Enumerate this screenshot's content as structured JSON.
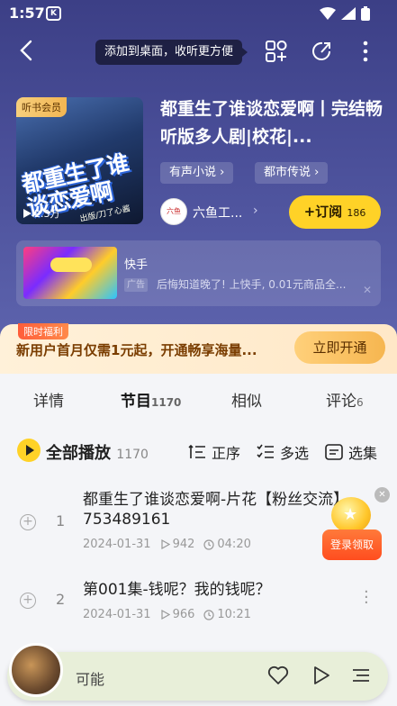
{
  "status": {
    "time": "1:57",
    "app_badge": "K"
  },
  "nav": {
    "tooltip": "添加到桌面，收听更方便"
  },
  "album": {
    "cover_badge": "听书会员",
    "cover_title": "都重生了谁谈恋爱啊",
    "cover_subtitle": "出版/刀了心酱",
    "cover_plays": "2.3万",
    "title": "都重生了谁谈恋爱啊丨完结畅听版多人剧|校花|...",
    "tags": [
      "有声小说",
      "都市传说"
    ],
    "author_name": "六鱼工...",
    "author_avatar_text": "六鱼",
    "subscribe_label": "+订阅",
    "subscribe_count": "186"
  },
  "ad": {
    "brand": "快手",
    "label": "广告",
    "text": "后悔知道晚了! 上快手, 0.01元商品全..."
  },
  "promo": {
    "badge": "限时福利",
    "text": "新用户首月仅需1元起，开通畅享海量...",
    "button": "立即开通"
  },
  "tabs": [
    {
      "label": "详情",
      "count": ""
    },
    {
      "label": "节目",
      "count": "1170"
    },
    {
      "label": "相似",
      "count": ""
    },
    {
      "label": "评论",
      "count": "6"
    }
  ],
  "toolbar": {
    "play_all": "全部播放",
    "play_all_count": "1170",
    "order": "正序",
    "multi_select": "多选",
    "select_episodes": "选集"
  },
  "episodes": [
    {
      "num": "1",
      "title": "都重生了谁谈恋爱啊-片花【粉丝交流】753489161",
      "date": "2024-01-31",
      "plays": "942",
      "duration": "04:20"
    },
    {
      "num": "2",
      "title": "第001集-钱呢？我的钱呢？",
      "date": "2024-01-31",
      "plays": "966",
      "duration": "10:21"
    }
  ],
  "float": {
    "button": "登录领取"
  },
  "player": {
    "title": "可能"
  },
  "colors": {
    "accent": "#ffd227",
    "header": "#454a94",
    "promo_text": "#7a3d00"
  }
}
